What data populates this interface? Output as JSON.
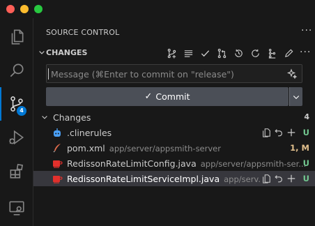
{
  "window": {
    "controls": [
      "close",
      "minimize",
      "zoom"
    ]
  },
  "activity_bar": {
    "items": [
      "files-icon",
      "search-icon",
      "source-control-icon",
      "run-debug-icon",
      "extensions-icon",
      "remote-explorer-icon"
    ],
    "source_control_badge": "4",
    "accent": "#0078d4"
  },
  "source_control": {
    "title": "SOURCE CONTROL",
    "more": "···",
    "section": {
      "label": "CHANGES",
      "toolbar_icons": [
        "graph-icon",
        "list-icon",
        "check-icon",
        "pull-request-icon",
        "history-icon",
        "refresh-icon",
        "git-graph-icon",
        "edit-icon"
      ],
      "more": "···"
    },
    "message_input": {
      "placeholder": "Message (⌘Enter to commit on \"release\")",
      "value": ""
    },
    "commit_button": {
      "label": "Commit",
      "icon": "✓"
    },
    "changes_group": {
      "label": "Changes",
      "count": "4"
    },
    "files": [
      {
        "name": ".clinerules",
        "path": "",
        "status": "U",
        "icon": "cline-icon"
      },
      {
        "name": "pom.xml",
        "path": "app/server/appsmith-server",
        "status": "1, M",
        "icon": "maven-icon"
      },
      {
        "name": "RedissonRateLimitConfig.java",
        "path": "app/server/appsmith-ser...",
        "status": "U",
        "icon": "java-icon"
      },
      {
        "name": "RedissonRateLimitServiceImpl.java",
        "path": "app/serv...",
        "status": "U",
        "icon": "java-icon"
      }
    ],
    "colors": {
      "untracked": "#73c991",
      "modified": "#e2c08d",
      "selection": "#37373d",
      "commit_button": "#4b4f57"
    }
  }
}
